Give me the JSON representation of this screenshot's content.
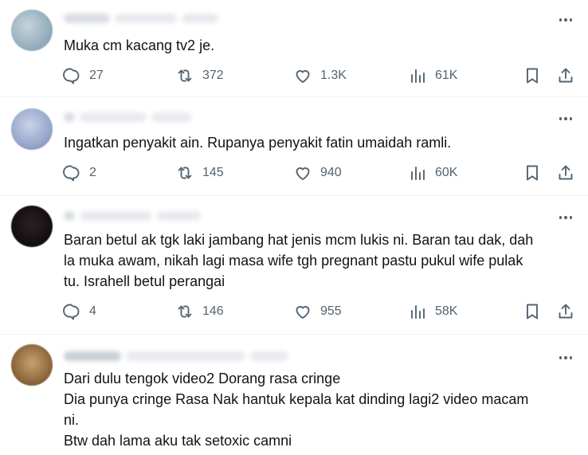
{
  "tweets": [
    {
      "text": "Muka cm kacang tv2 je.",
      "replies": "27",
      "retweets": "372",
      "likes": "1.3K",
      "views": "61K",
      "avatar_color": "#9cb3c4"
    },
    {
      "text": "Ingatkan penyakit ain. Rupanya penyakit fatin umaidah ramli.",
      "replies": "2",
      "retweets": "145",
      "likes": "940",
      "views": "60K",
      "avatar_color": "#a7b6d6"
    },
    {
      "text": "Baran betul ak tgk laki jambang hat jenis mcm lukis ni. Baran tau dak, dah\nla muka awam, nikah lagi masa wife tgh pregnant pastu pukul wife pulak\ntu. Israhell betul perangai",
      "replies": "4",
      "retweets": "146",
      "likes": "955",
      "views": "58K",
      "avatar_color": "#1a1416"
    },
    {
      "text": "Dari dulu tengok video2 Dorang rasa cringe\nDia punya cringe Rasa Nak hantuk kepala kat dinding lagi2 video macam\nni.\nBtw dah lama aku tak setoxic camni",
      "avatar_color": "#9c7a52"
    }
  ],
  "icons": {
    "more": "more-options-icon",
    "reply": "reply-icon",
    "retweet": "retweet-icon",
    "like": "like-icon",
    "views": "views-icon",
    "bookmark": "bookmark-icon",
    "share": "share-icon"
  },
  "colors": {
    "text": "#0f1419",
    "secondary": "#536471",
    "divider": "#eff3f4"
  }
}
